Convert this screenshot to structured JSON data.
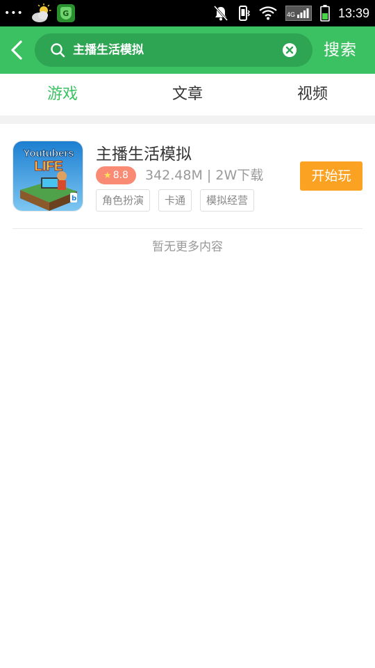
{
  "status_bar": {
    "time": "13:39",
    "network_label": "4G",
    "icons": [
      "more-dots-icon",
      "weather-icon",
      "app-notification-icon",
      "mute-icon",
      "vibrate-icon",
      "wifi-icon",
      "signal-icon",
      "battery-icon"
    ]
  },
  "header": {
    "search_query": "主播生活模拟",
    "search_button_label": "搜索",
    "accent_color": "#3cc162"
  },
  "tabs": [
    {
      "label": "游戏",
      "active": true
    },
    {
      "label": "文章",
      "active": false
    },
    {
      "label": "视频",
      "active": false
    }
  ],
  "results": [
    {
      "name": "主播生活模拟",
      "rating": "8.8",
      "meta": "342.48M | 2W下载",
      "tags": [
        "角色扮演",
        "卡通",
        "模拟经营"
      ],
      "action_label": "开始玩",
      "icon_text_top": "Youtubers",
      "icon_text_bottom": "LIFE"
    }
  ],
  "footer_note": "暂无更多内容"
}
